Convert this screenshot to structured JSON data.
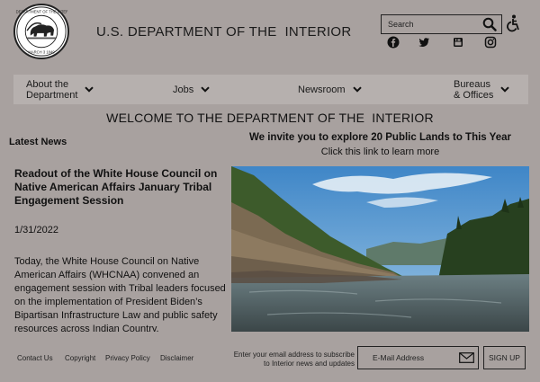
{
  "header": {
    "seal_text_top": "U.S. DEPARTMENT OF THE INTERIOR",
    "seal_text_bottom": "MARCH 3 1849",
    "title": "U.S. DEPARTMENT OF THE  INTERIOR",
    "search_placeholder": "Search",
    "social": [
      "facebook-icon",
      "twitter-icon",
      "youtube-icon",
      "instagram-icon"
    ]
  },
  "nav": {
    "items": [
      {
        "label_line1": "About the",
        "label_line2": "Department"
      },
      {
        "label_line1": "Jobs",
        "label_line2": ""
      },
      {
        "label_line1": "Newsroom",
        "label_line2": ""
      },
      {
        "label_line1": "Bureaus",
        "label_line2": "& Offices"
      }
    ]
  },
  "main": {
    "welcome": "WELCOME TO THE DEPARTMENT OF THE  INTERIOR",
    "latest_news_heading": "Latest News",
    "article": {
      "title": "Readout of the White House Council on Native American Affairs January Tribal Engagement Session",
      "date": "1/31/2022",
      "body": "Today, the White House Council on Native American Affairs (WHCNAA) convened an engagement session with Tribal leaders focused on the implementation of President Biden’s Bipartisan Infrastructure Law and public safety resources across Indian Country."
    },
    "promo": {
      "title": "We invite you to explore 20 Public Lands to This Year",
      "link": "Click this link to learn more"
    }
  },
  "footer": {
    "links": [
      "Contact Us",
      "Copyright",
      "Privacy Policy",
      "Disclaimer"
    ],
    "newsletter_line1": "Enter your email address to subscribe",
    "newsletter_line2": "to Interior news and updates",
    "email_placeholder": "E-Mail Address",
    "signup_label": "SIGN UP"
  }
}
